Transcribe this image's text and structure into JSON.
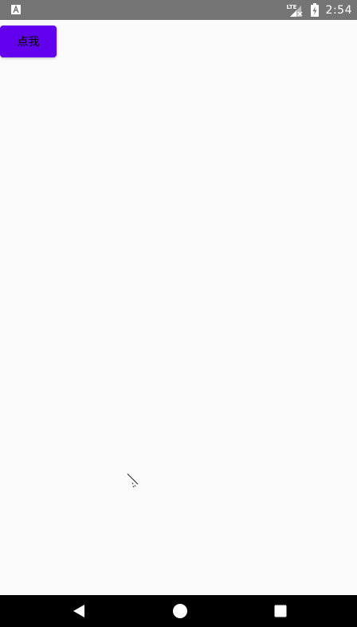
{
  "status_bar": {
    "network_label": "LTE",
    "time": "2:54",
    "icons": {
      "app": "app-notification-icon",
      "signal": "signal-no-data-icon",
      "battery": "battery-charging-icon"
    }
  },
  "main": {
    "button_label": "点我"
  },
  "navigation": {
    "back": "back-icon",
    "home": "home-icon",
    "recents": "recents-icon"
  },
  "colors": {
    "status_bar": "#757575",
    "background": "#fafafa",
    "accent": "#6200ee",
    "nav_bar": "#000000"
  }
}
